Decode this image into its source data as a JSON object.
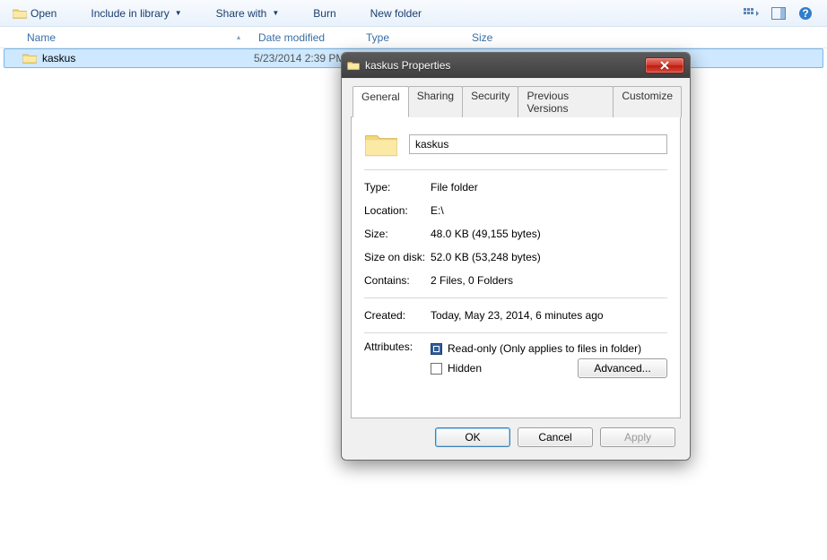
{
  "toolbar": {
    "open": "Open",
    "include": "Include in library",
    "share": "Share with",
    "burn": "Burn",
    "new_folder": "New folder"
  },
  "columns": {
    "name": "Name",
    "date": "Date modified",
    "type": "Type",
    "size": "Size"
  },
  "file": {
    "name": "kaskus",
    "date": "5/23/2014 2:39 PM"
  },
  "dialog": {
    "title": "kaskus Properties",
    "tabs": {
      "general": "General",
      "sharing": "Sharing",
      "security": "Security",
      "previous": "Previous Versions",
      "customize": "Customize"
    },
    "name_value": "kaskus",
    "rows": {
      "type_label": "Type:",
      "type_value": "File folder",
      "location_label": "Location:",
      "location_value": "E:\\",
      "size_label": "Size:",
      "size_value": "48.0 KB (49,155 bytes)",
      "sizeondisk_label": "Size on disk:",
      "sizeondisk_value": "52.0 KB (53,248 bytes)",
      "contains_label": "Contains:",
      "contains_value": "2 Files, 0 Folders",
      "created_label": "Created:",
      "created_value": "Today, May 23, 2014, 6 minutes ago",
      "attributes_label": "Attributes:",
      "readonly_label": "Read-only (Only applies to files in folder)",
      "hidden_label": "Hidden",
      "advanced": "Advanced..."
    },
    "buttons": {
      "ok": "OK",
      "cancel": "Cancel",
      "apply": "Apply"
    }
  }
}
